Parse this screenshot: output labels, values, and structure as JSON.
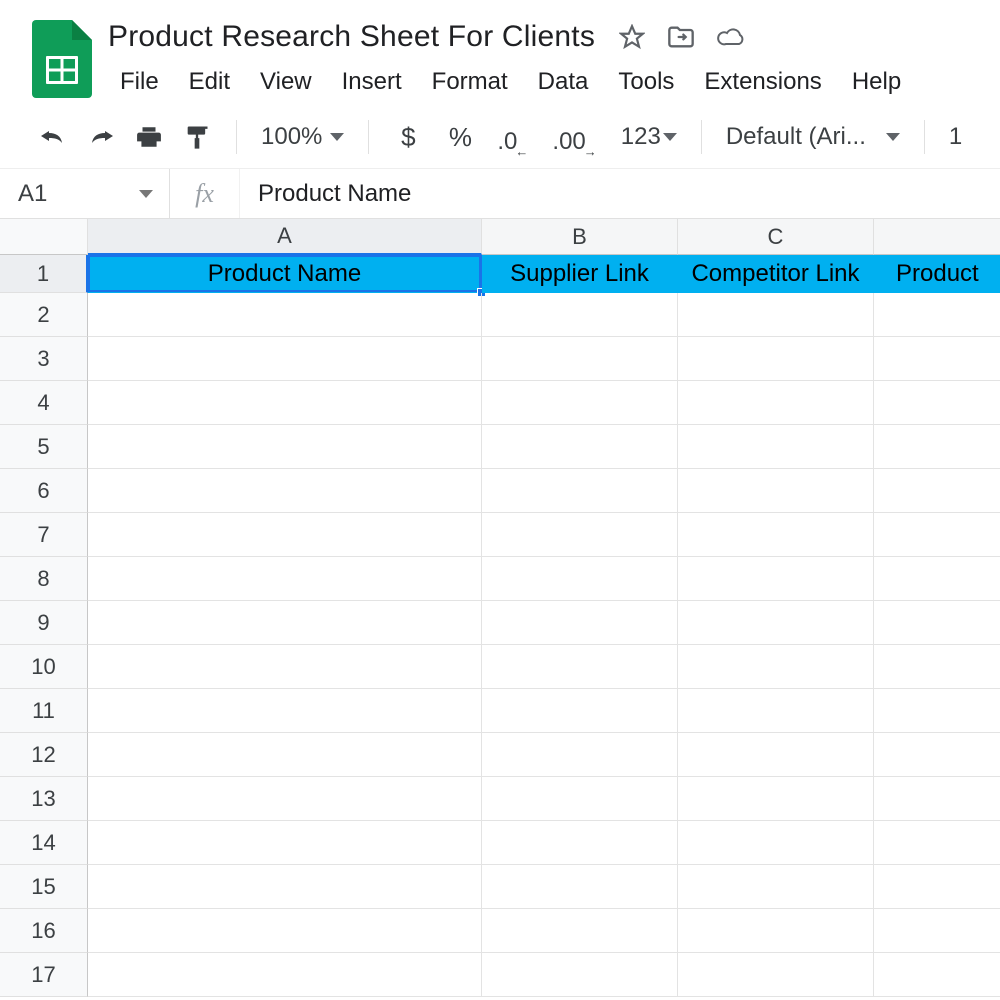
{
  "doc": {
    "title": "Product Research Sheet For Clients"
  },
  "menu": {
    "file": "File",
    "edit": "Edit",
    "view": "View",
    "insert": "Insert",
    "format": "Format",
    "data": "Data",
    "tools": "Tools",
    "extensions": "Extensions",
    "help": "Help"
  },
  "toolbar": {
    "zoom": "100%",
    "currency": "$",
    "percent": "%",
    "dec_decrease": ".0",
    "dec_increase": ".00",
    "more_formats": "123",
    "font": "Default (Ari...",
    "font_size_partial": "1"
  },
  "name_box": "A1",
  "fx": "fx",
  "formula_value": "Product Name",
  "cols": {
    "A": "A",
    "B": "B",
    "C": "C",
    "D": ""
  },
  "rows": {
    "r1": "1",
    "r2": "2",
    "r3": "3",
    "r4": "4",
    "r5": "5",
    "r6": "6",
    "r7": "7",
    "r8": "8",
    "r9": "9",
    "r10": "10",
    "r11": "11",
    "r12": "12",
    "r13": "13",
    "r14": "14",
    "r15": "15",
    "r16": "16",
    "r17": "17"
  },
  "headers": {
    "A": "Product Name",
    "B": "Supplier Link",
    "C": "Competitor Link",
    "D": "Product"
  }
}
